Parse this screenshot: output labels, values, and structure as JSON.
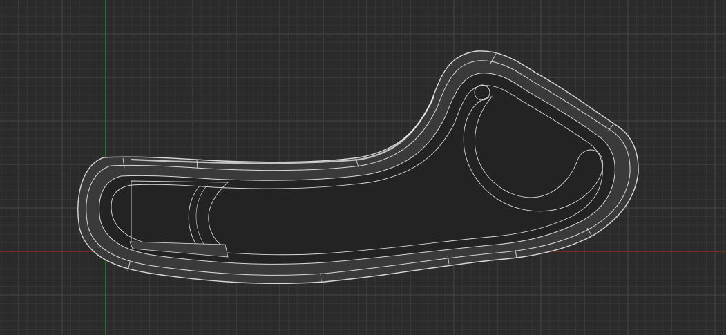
{
  "viewport": {
    "background": "#2b2b2b",
    "grid_minor_color": "#373737",
    "grid_major_color": "#474747",
    "axis_x_color": "#a02828",
    "axis_y_color": "#1f9a2a"
  },
  "model": {
    "body_color": "#232323",
    "rim_color": "#3a3a3a",
    "edge_color": "#d8d8d8",
    "highlight_color": "#f2f2f2"
  }
}
